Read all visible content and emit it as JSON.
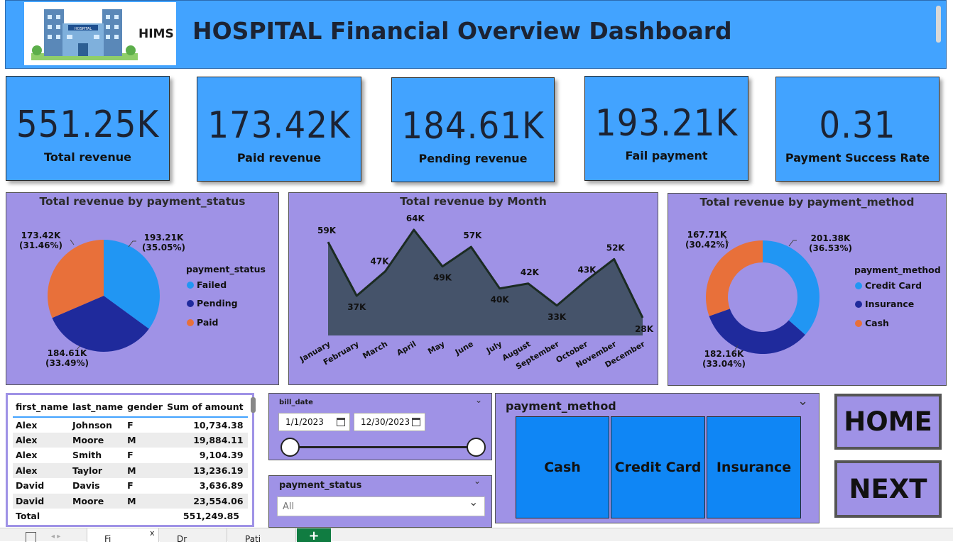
{
  "header": {
    "logo_text": "HIMS",
    "logo_sign": "HOSPITAL",
    "title": "HOSPITAL Financial Overview Dashboard"
  },
  "kpis": [
    {
      "value": "551.25K",
      "label": "Total revenue"
    },
    {
      "value": "173.42K",
      "label": "Paid revenue"
    },
    {
      "value": "184.61K",
      "label": "Pending revenue"
    },
    {
      "value": "193.21K",
      "label": "Fail payment"
    },
    {
      "value": "0.31",
      "label": "Payment Success Rate"
    }
  ],
  "colors": {
    "accent_blue": "#42a3ff",
    "panel_purple": "#9f92e6",
    "slice_blue": "#2196f3",
    "slice_navy": "#1f2a9c",
    "slice_orange": "#e8703a",
    "area_fill": "#45536a",
    "button_blue": "#0f86f5"
  },
  "status_panel": {
    "title": "Total revenue by payment_status",
    "legend_title": "payment_status",
    "labels": [
      {
        "line1": "193.21K",
        "line2": "(35.05%)"
      },
      {
        "line1": "184.61K",
        "line2": "(33.49%)"
      },
      {
        "line1": "173.42K",
        "line2": "(31.46%)"
      }
    ],
    "legend": [
      "Failed",
      "Pending",
      "Paid"
    ]
  },
  "month_panel": {
    "title": "Total revenue by Month"
  },
  "method_panel": {
    "title": "Total revenue by payment_method",
    "legend_title": "payment_method",
    "labels": [
      {
        "line1": "201.38K",
        "line2": "(36.53%)"
      },
      {
        "line1": "182.16K",
        "line2": "(33.04%)"
      },
      {
        "line1": "167.71K",
        "line2": "(30.42%)"
      }
    ],
    "legend": [
      "Credit Card",
      "Insurance",
      "Cash"
    ]
  },
  "chart_data": [
    {
      "type": "pie",
      "title": "Total revenue by payment_status",
      "legend_title": "payment_status",
      "categories": [
        "Failed",
        "Pending",
        "Paid"
      ],
      "values": [
        193.21,
        184.61,
        173.42
      ],
      "unit": "K",
      "percent": [
        35.05,
        33.49,
        31.46
      ],
      "colors": [
        "#2196f3",
        "#1f2a9c",
        "#e8703a"
      ],
      "legend_position": "right"
    },
    {
      "type": "area",
      "title": "Total revenue by Month",
      "categories": [
        "January",
        "February",
        "March",
        "April",
        "May",
        "June",
        "July",
        "August",
        "September",
        "October",
        "November",
        "December"
      ],
      "values": [
        59,
        37,
        47,
        64,
        49,
        57,
        40,
        42,
        33,
        43,
        52,
        28
      ],
      "data_labels": [
        "59K",
        "37K",
        "47K",
        "64K",
        "49K",
        "57K",
        "40K",
        "42K",
        "33K",
        "43K",
        "52K",
        "28K"
      ],
      "unit": "K",
      "ylim": [
        0,
        64
      ],
      "grid": false
    },
    {
      "type": "pie",
      "donut": true,
      "title": "Total revenue by payment_method",
      "legend_title": "payment_method",
      "categories": [
        "Credit Card",
        "Insurance",
        "Cash"
      ],
      "values": [
        201.38,
        182.16,
        167.71
      ],
      "unit": "K",
      "percent": [
        36.53,
        33.04,
        30.42
      ],
      "colors": [
        "#2196f3",
        "#1f2a9c",
        "#e8703a"
      ],
      "legend_position": "right"
    }
  ],
  "table": {
    "headers": [
      "first_name",
      "last_name",
      "gender",
      "Sum of amount"
    ],
    "rows": [
      [
        "Alex",
        "Johnson",
        "F",
        "10,734.38"
      ],
      [
        "Alex",
        "Moore",
        "M",
        "19,884.11"
      ],
      [
        "Alex",
        "Smith",
        "F",
        "9,104.39"
      ],
      [
        "Alex",
        "Taylor",
        "M",
        "13,236.19"
      ],
      [
        "David",
        "Davis",
        "F",
        "3,636.89"
      ],
      [
        "David",
        "Moore",
        "M",
        "23,554.06"
      ]
    ],
    "total_label": "Total",
    "total_value": "551,249.85"
  },
  "bill_date": {
    "title": "bill_date",
    "start": "1/1/2023",
    "end": "12/30/2023"
  },
  "status_slicer": {
    "title": "payment_status",
    "value": "All"
  },
  "method_slicer": {
    "title": "payment_method",
    "options": [
      "Cash",
      "Credit Card",
      "Insurance"
    ]
  },
  "nav": {
    "home": "HOME",
    "next": "NEXT"
  },
  "tabs": {
    "active": "Fi",
    "close": "x",
    "tab2": "Dr",
    "tab3": "Pati",
    "add": "+"
  }
}
